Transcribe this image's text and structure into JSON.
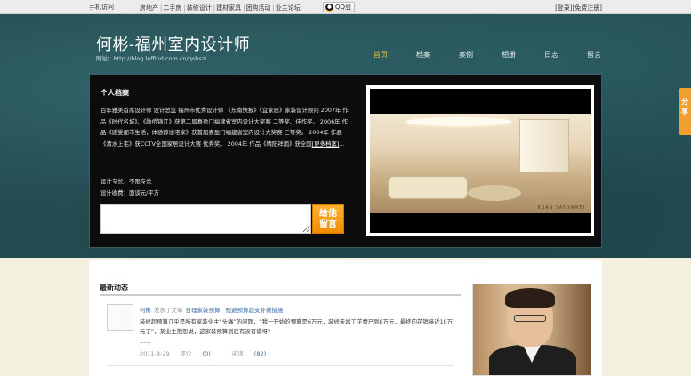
{
  "topbar": {
    "mobile_label": "手机访问",
    "links": [
      "房地产",
      "二手房",
      "装修设计",
      "建材家具",
      "团购活动",
      "业主论坛"
    ],
    "qq_label": "QQ登",
    "auth_text": "[登录][免费注册]"
  },
  "header": {
    "site_title": "何彬-福州室内设计师",
    "site_url": "网址：http://blog.leffind.com.cn/qshsz/"
  },
  "nav": {
    "items": [
      "首页",
      "档案",
      "案例",
      "相册",
      "日志",
      "留言"
    ],
    "active": "首页"
  },
  "profile": {
    "title": "个人档案",
    "bio": "百年雅美首席设计师 设计总监 福州市优秀设计师 《东南快报》《宜家居》家装设计顾问 2007年 作品《时代名城》、《融侨锦江》获第二届喜盈门福建省室内设计大奖赛 二等奖、佳作奖。 2006年 作品《感受都市生活，体验静谧宅家》获首届喜盈门福建省室内设计大奖赛 三等奖。 2004年 作品《清水上宅》获CCTV全国家居设计大赛 优秀奖。 2004年 作品《晴阳祥雨》获全国",
    "more_link": "[更多档案]",
    "bio_tail": "...",
    "specialty": "设计专长：不限专长",
    "fee": "设计收费：面谈元/平方",
    "message_button": "给他留言",
    "photo_watermark": "KUAN YANYAMEI"
  },
  "share_tab": "分享",
  "feed": {
    "section_title": "最新动态",
    "items": [
      {
        "author": "何彬",
        "verb": "发表了文章",
        "tags": [
          "合理家装预算",
          "规避预算超支补救措施"
        ],
        "body": "装修超预算几乎是所有家装业主“头痛”的问题，“我一开始的预算是6万元，装修未竣工花费已到8万元，最终的花销接近10万元了”，某业主抱怨说，这家装预算到底有没有谱呀?",
        "ellipsis": "......",
        "date": "2011-8-29",
        "comments_label": "评论",
        "comments_count": "(0)",
        "reads_label": "阅读",
        "reads_count": "(82)"
      }
    ]
  },
  "colors": {
    "header_bg": "#234a4f",
    "nav_active": "#f2c23a",
    "accent_orange": "#f08c00",
    "link_blue": "#3a6aa8"
  }
}
